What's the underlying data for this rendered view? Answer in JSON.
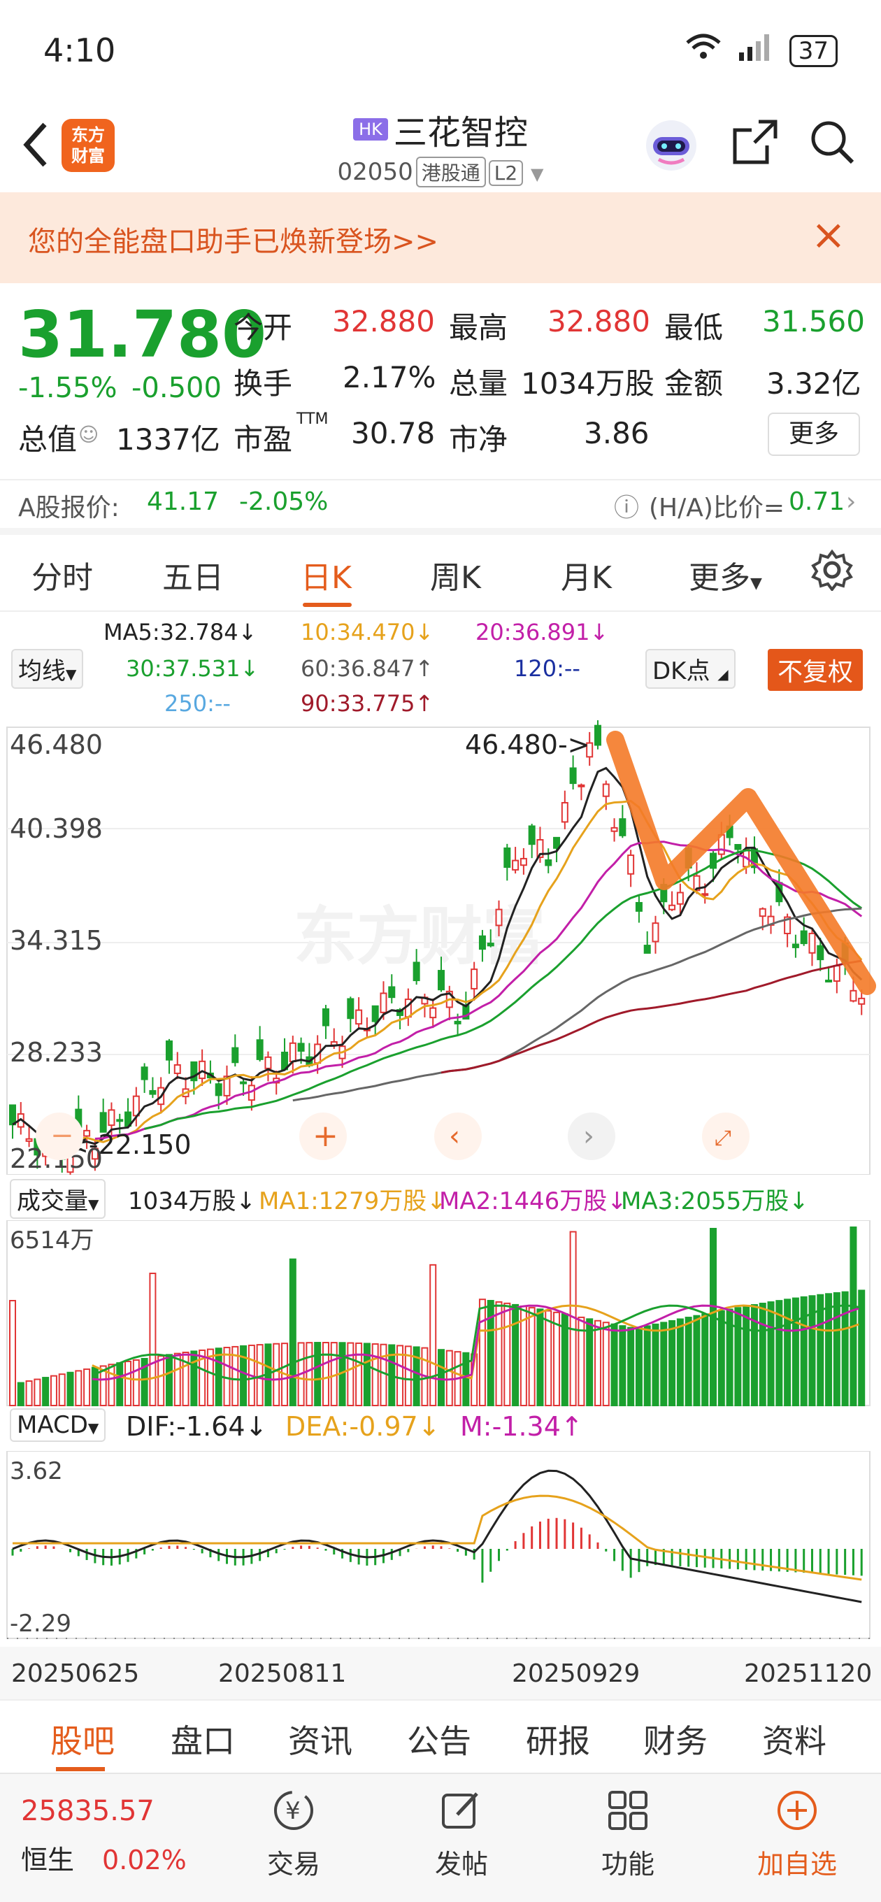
{
  "status": {
    "time": "4:10",
    "battery": "37"
  },
  "header": {
    "market_tag": "HK",
    "title": "三花智控",
    "code": "02050",
    "tag1": "港股通",
    "tag2": "L2",
    "logo": "东方\n财富"
  },
  "banner": {
    "text": "您的全能盘口助手已焕新登场>>",
    "close": "×"
  },
  "quote": {
    "price": "31.780",
    "pct": "-1.55%",
    "chg": "-0.500",
    "open_label": "今开",
    "open": "32.880",
    "high_label": "最高",
    "high": "32.880",
    "low_label": "最低",
    "low": "31.560",
    "turnover_label": "换手",
    "turnover": "2.17%",
    "vol_label": "总量",
    "vol": "1034万股",
    "amt_label": "金额",
    "amt": "3.32亿",
    "mcap_label": "总值",
    "mcap": "1337亿",
    "pe_label": "市盈",
    "pe_sup": "TTM",
    "pe": "30.78",
    "pb_label": "市净",
    "pb": "3.86",
    "more": "更多"
  },
  "ah": {
    "label": "A股报价:",
    "price": "41.17",
    "pct": "-2.05%",
    "ratio_label": "(H/A)比价=",
    "ratio": "0.71"
  },
  "tabs": [
    "分时",
    "五日",
    "日K",
    "周K",
    "月K",
    "更多"
  ],
  "ma": {
    "selector": "均线",
    "ma5": "MA5:32.784↓",
    "ma10": "10:34.470↓",
    "ma20": "20:36.891↓",
    "ma30": "30:37.531↓",
    "ma60": "60:36.847↑",
    "ma120": "120:--",
    "ma250": "250:--",
    "ma90": "90:33.775↑",
    "dk": "DK点",
    "fq": "不复权"
  },
  "kline": {
    "y_labels": [
      "46.480",
      "40.398",
      "34.315",
      "28.233",
      "22.150"
    ],
    "max_label": "46.480->",
    "min_label": "<-22.150",
    "watermark": "东方财富"
  },
  "volume": {
    "selector": "成交量",
    "cur": "1034万股↓",
    "ma1": "MA1:1279万股↓",
    "ma2": "MA2:1446万股↓",
    "ma3": "MA3:2055万股↓",
    "top": "6514万"
  },
  "macd": {
    "selector": "MACD",
    "dif": "DIF:-1.64↓",
    "dea": "DEA:-0.97↓",
    "m": "M:-1.34↑",
    "top": "3.62",
    "bottom": "-2.29"
  },
  "dates": [
    "20250625",
    "20250811",
    "20250929",
    "20251120"
  ],
  "bottom_tabs": [
    "股吧",
    "盘口",
    "资讯",
    "公告",
    "研报",
    "财务",
    "资料"
  ],
  "footer": {
    "index_value": "25835.57",
    "index_name": "恒生",
    "index_pct": "0.02%",
    "trade": "交易",
    "post": "发帖",
    "func": "功能",
    "add": "加自选"
  }
}
